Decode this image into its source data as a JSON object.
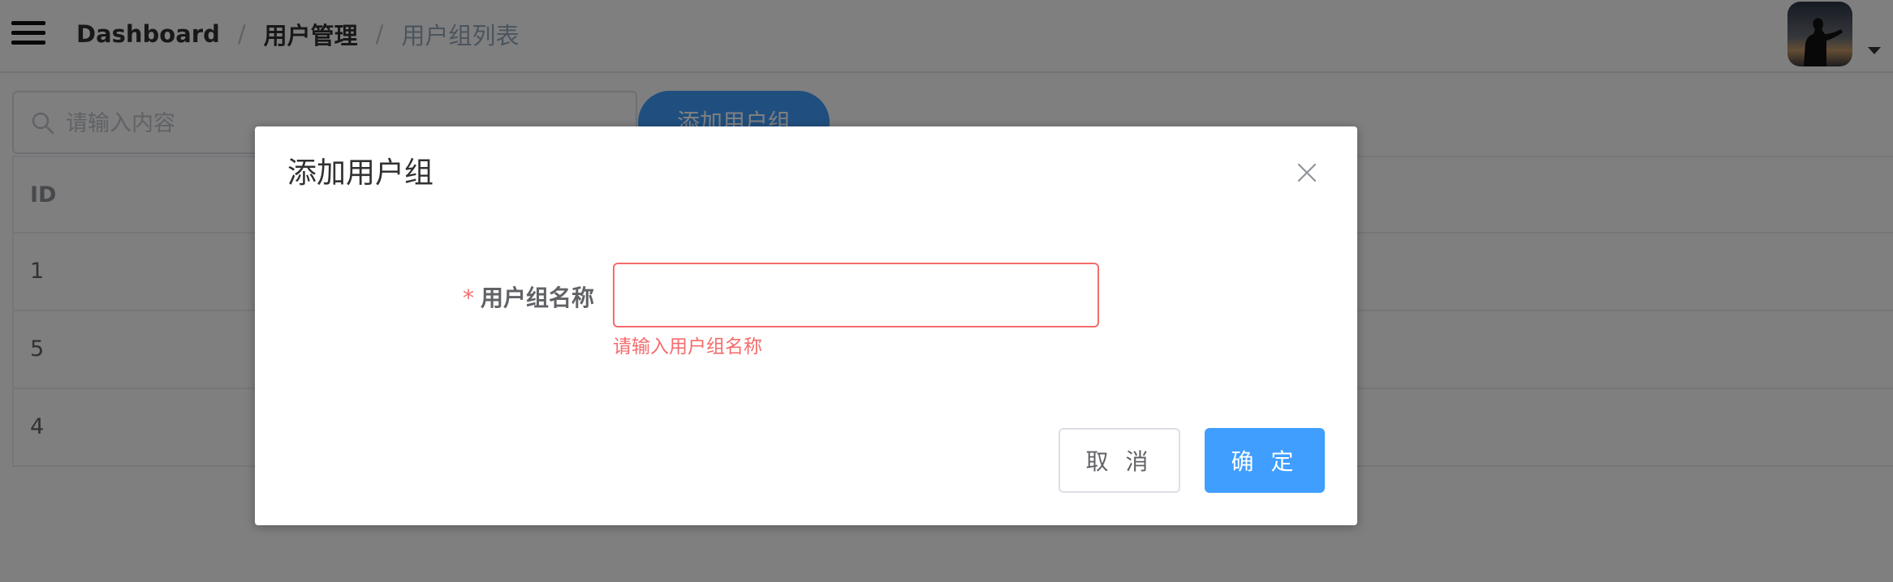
{
  "header": {
    "breadcrumb": [
      {
        "label": "Dashboard"
      },
      {
        "label": "用户管理"
      },
      {
        "label": "用户组列表"
      }
    ],
    "separator": "/"
  },
  "toolbar": {
    "search_placeholder": "请输入内容",
    "search_value": "",
    "add_button_label": "添加用户组"
  },
  "table": {
    "columns": [
      "ID"
    ],
    "rows": [
      {
        "id": "1"
      },
      {
        "id": "5"
      },
      {
        "id": "4"
      }
    ]
  },
  "dialog": {
    "title": "添加用户组",
    "field": {
      "required_mark": "*",
      "label": "用户组名称",
      "value": "",
      "error": "请输入用户组名称"
    },
    "cancel_label": "取 消",
    "confirm_label": "确 定"
  },
  "colors": {
    "primary": "#409eff",
    "danger": "#f56c6c",
    "overlay": "rgba(0,0,0,0.5)"
  }
}
